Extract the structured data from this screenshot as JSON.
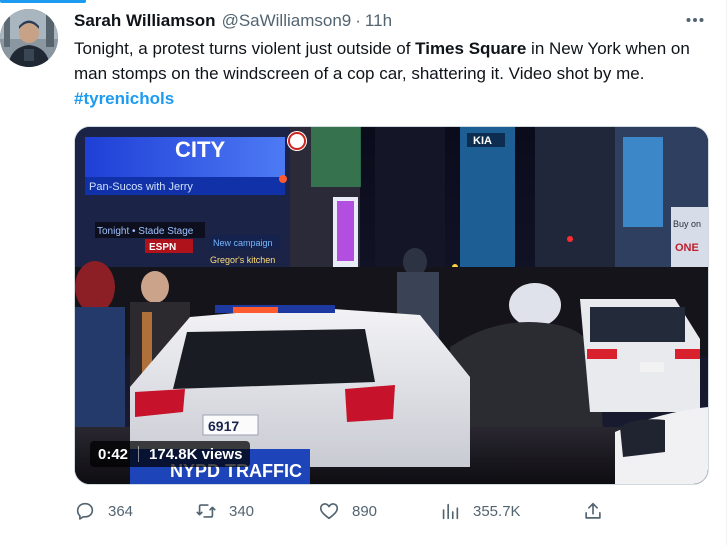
{
  "tweet": {
    "author_name": "Sarah Williamson",
    "author_handle": "@SaWilliamson9",
    "separator": "·",
    "time": "11h",
    "text_before": "Tonight, a protest turns violent just outside of ",
    "text_bold": "Times Square",
    "text_after": " in New York when on man stomps on the windscreen of a cop car, shattering it. Video shot by me. ",
    "hashtag": "#tyrenichols"
  },
  "media": {
    "duration": "0:42",
    "views": "174.8K views",
    "scene_signs": {
      "city": "CITY",
      "sign_left": "Pan-Sucos with Jerry",
      "ad_line": "Tonight • Stade Stage",
      "espn": "ESPN",
      "campaign": "New campaign",
      "cregor": "Gregor's kitchen",
      "plate": "6917",
      "car_text": "NYPD TRAFFIC",
      "kia": "KIA",
      "sidebar": "Buy on",
      "brand": "ONE"
    }
  },
  "actions": {
    "replies": "364",
    "retweets": "340",
    "likes": "890",
    "views": "355.7K"
  },
  "icons": {
    "more": "more-icon",
    "reply": "reply-icon",
    "retweet": "retweet-icon",
    "like": "heart-icon",
    "views": "analytics-icon",
    "share": "share-icon"
  },
  "colors": {
    "accent": "#1d9bf0",
    "text": "#0f1419",
    "secondary": "#536471",
    "border": "#cfd9de"
  }
}
